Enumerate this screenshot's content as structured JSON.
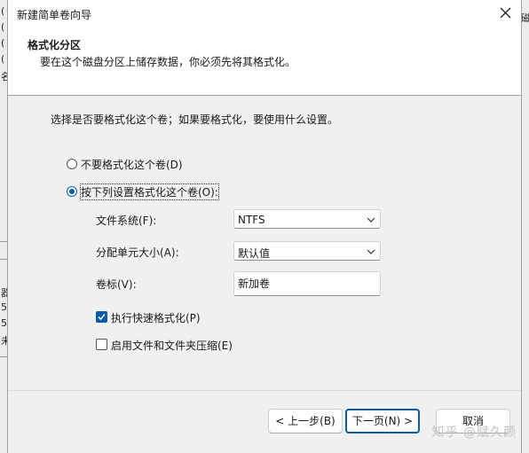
{
  "background_app": {
    "left_fragments": [
      "(",
      "(",
      "(",
      "(",
      "名",
      "器",
      "5",
      "5",
      "未"
    ],
    "right_fragment": "磁"
  },
  "dialog": {
    "title": "新建简单卷向导",
    "close_icon": "close-icon"
  },
  "header": {
    "title": "格式化分区",
    "subtitle": "要在这个磁盘分区上储存数据，你必须先将其格式化。"
  },
  "instruction": "选择是否要格式化这个卷；如果要格式化，要使用什么设置。",
  "options": {
    "no_format": {
      "label": "不要格式化这个卷(D)",
      "selected": false
    },
    "format": {
      "label": "按下列设置格式化这个卷(O):",
      "selected": true
    }
  },
  "fields": {
    "filesystem": {
      "label": "文件系统(F):",
      "value": "NTFS"
    },
    "allocation": {
      "label": "分配单元大小(A):",
      "value": "默认值"
    },
    "volume_label": {
      "label": "卷标(V):",
      "value": "新加卷"
    }
  },
  "checkboxes": {
    "quick_format": {
      "label": "执行快速格式化(P)",
      "checked": true
    },
    "compression": {
      "label": "启用文件和文件夹压缩(E)",
      "checked": false
    }
  },
  "buttons": {
    "back": "< 上一步(B)",
    "next": "下一页(N) >",
    "cancel": "取消"
  },
  "watermark": "知乎 @赋久颜",
  "colors": {
    "accent": "#0b5cad",
    "dialog_bg": "#f0f0f0",
    "header_bg": "#ffffff"
  }
}
